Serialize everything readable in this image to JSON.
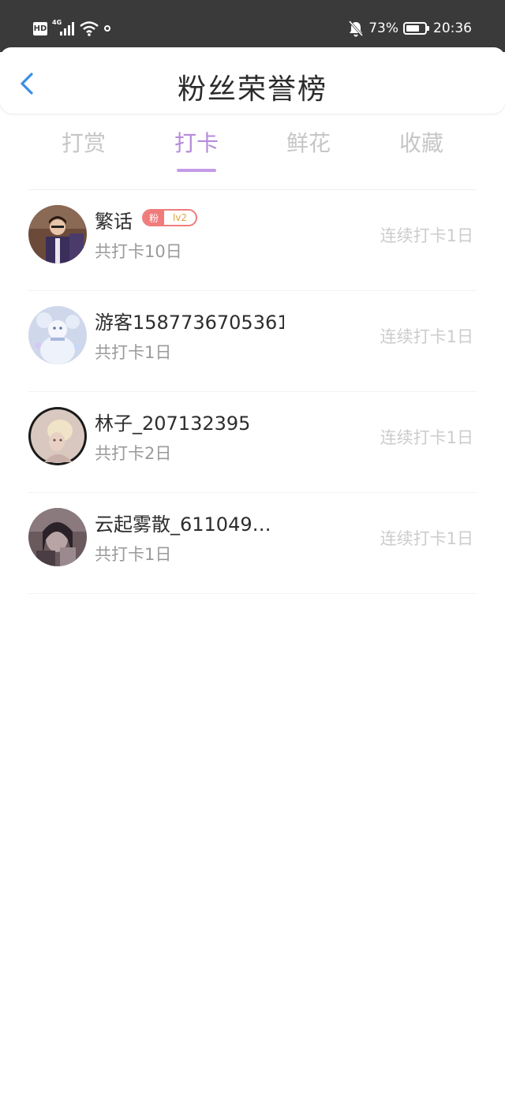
{
  "status_bar": {
    "left_badge": "HD",
    "network": "4G",
    "battery_percent": "73%",
    "battery_level": 0.73,
    "time": "20:36"
  },
  "header": {
    "title": "粉丝荣誉榜"
  },
  "tabs": [
    {
      "label": "打赏",
      "active": false
    },
    {
      "label": "打卡",
      "active": true
    },
    {
      "label": "鲜花",
      "active": false
    },
    {
      "label": "收藏",
      "active": false
    }
  ],
  "list": [
    {
      "name": "繁话",
      "badge": {
        "prefix": "粉",
        "level": "lv2"
      },
      "total": "共打卡10日",
      "streak": "连续打卡1日"
    },
    {
      "name": "游客1587736705361",
      "total": "共打卡1日",
      "streak": "连续打卡1日"
    },
    {
      "name": "林子_207132395",
      "total": "共打卡2日",
      "streak": "连续打卡1日"
    },
    {
      "name": "云起雾散_611049…",
      "total": "共打卡1日",
      "streak": "连续打卡1日"
    }
  ],
  "colors": {
    "accent": "#b58bdc",
    "underline": "#c39be6",
    "back_arrow": "#3a8ee6",
    "badge_red": "#f07b7b",
    "badge_level": "#e6a23c"
  }
}
